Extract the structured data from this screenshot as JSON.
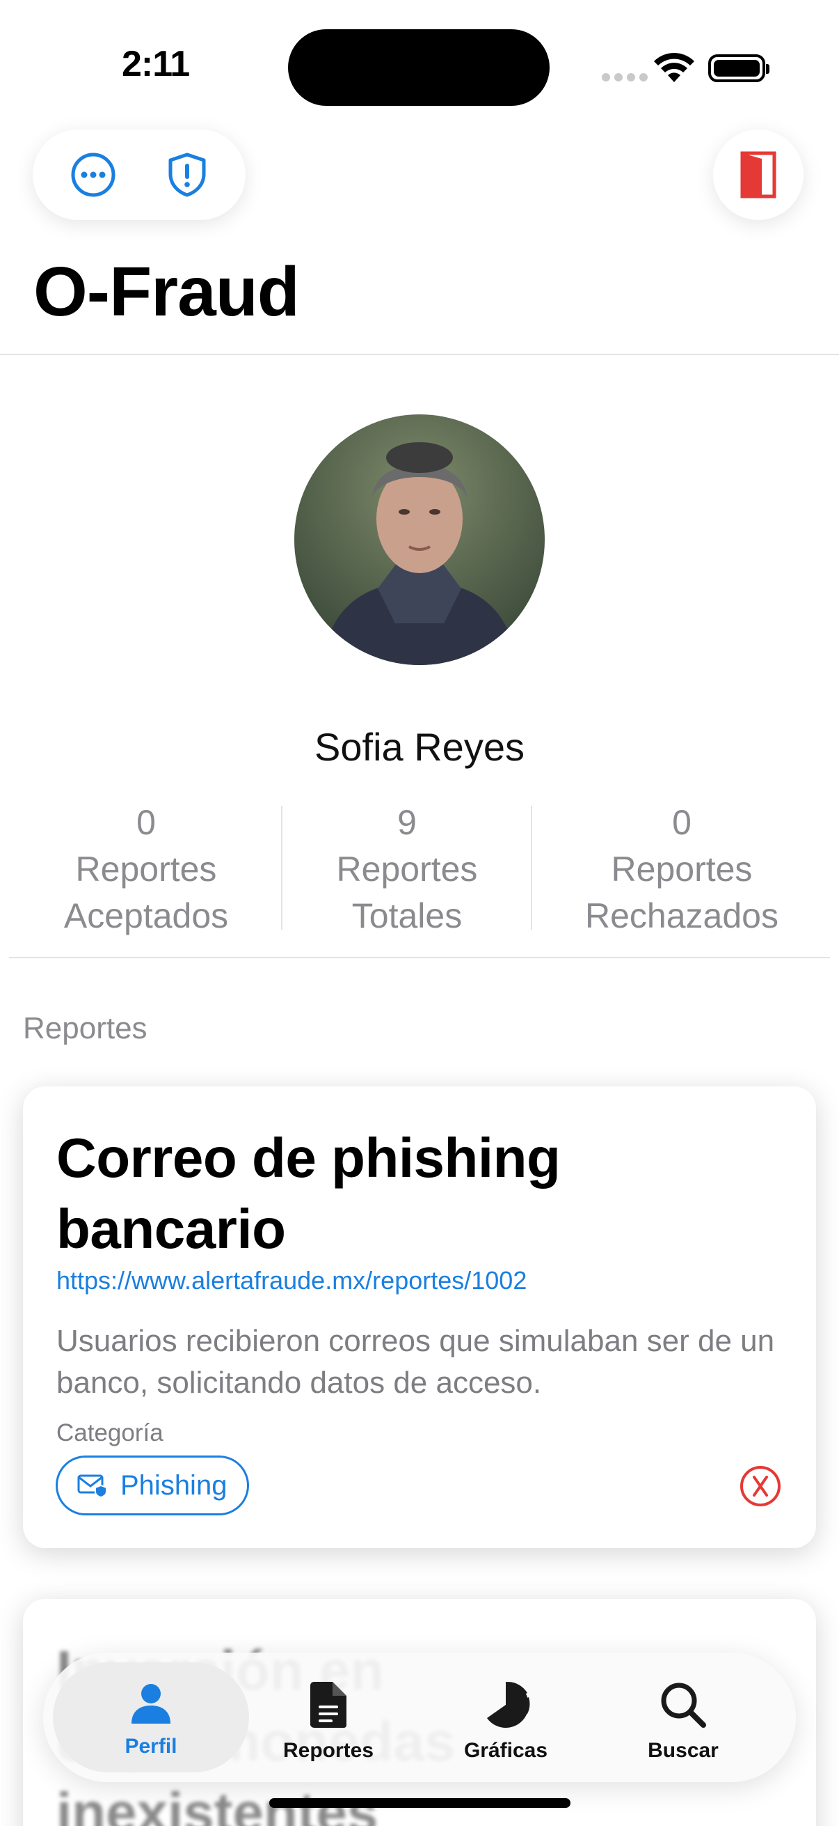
{
  "status_bar": {
    "time": "2:11"
  },
  "header": {
    "title": "O-Fraud"
  },
  "profile": {
    "name": "Sofia Reyes",
    "stats": [
      {
        "value": "0",
        "label_line1": "Reportes",
        "label_line2": "Aceptados"
      },
      {
        "value": "9",
        "label_line1": "Reportes",
        "label_line2": "Totales"
      },
      {
        "value": "0",
        "label_line1": "Reportes",
        "label_line2": "Rechazados"
      }
    ]
  },
  "reports_section": {
    "label": "Reportes",
    "cards": [
      {
        "title": "Correo de phishing bancario",
        "url": "https://www.alertafraude.mx/reportes/1002",
        "description": "Usuarios recibieron correos que simulaban ser de un banco, solicitando datos de acceso.",
        "category_label": "Categoría",
        "category": "Phishing",
        "status_icon": "x-circle-icon"
      },
      {
        "title": "Inversión en criptomonedas inexistentes"
      }
    ]
  },
  "tabbar": {
    "tabs": [
      {
        "label": "Perfil",
        "icon": "person-icon",
        "active": true
      },
      {
        "label": "Reportes",
        "icon": "document-icon",
        "active": false
      },
      {
        "label": "Gráficas",
        "icon": "pie-chart-icon",
        "active": false
      },
      {
        "label": "Buscar",
        "icon": "search-icon",
        "active": false
      }
    ]
  },
  "colors": {
    "accent": "#1a7fe0",
    "danger": "#e53935",
    "secondary_text": "#8a8a8f"
  }
}
